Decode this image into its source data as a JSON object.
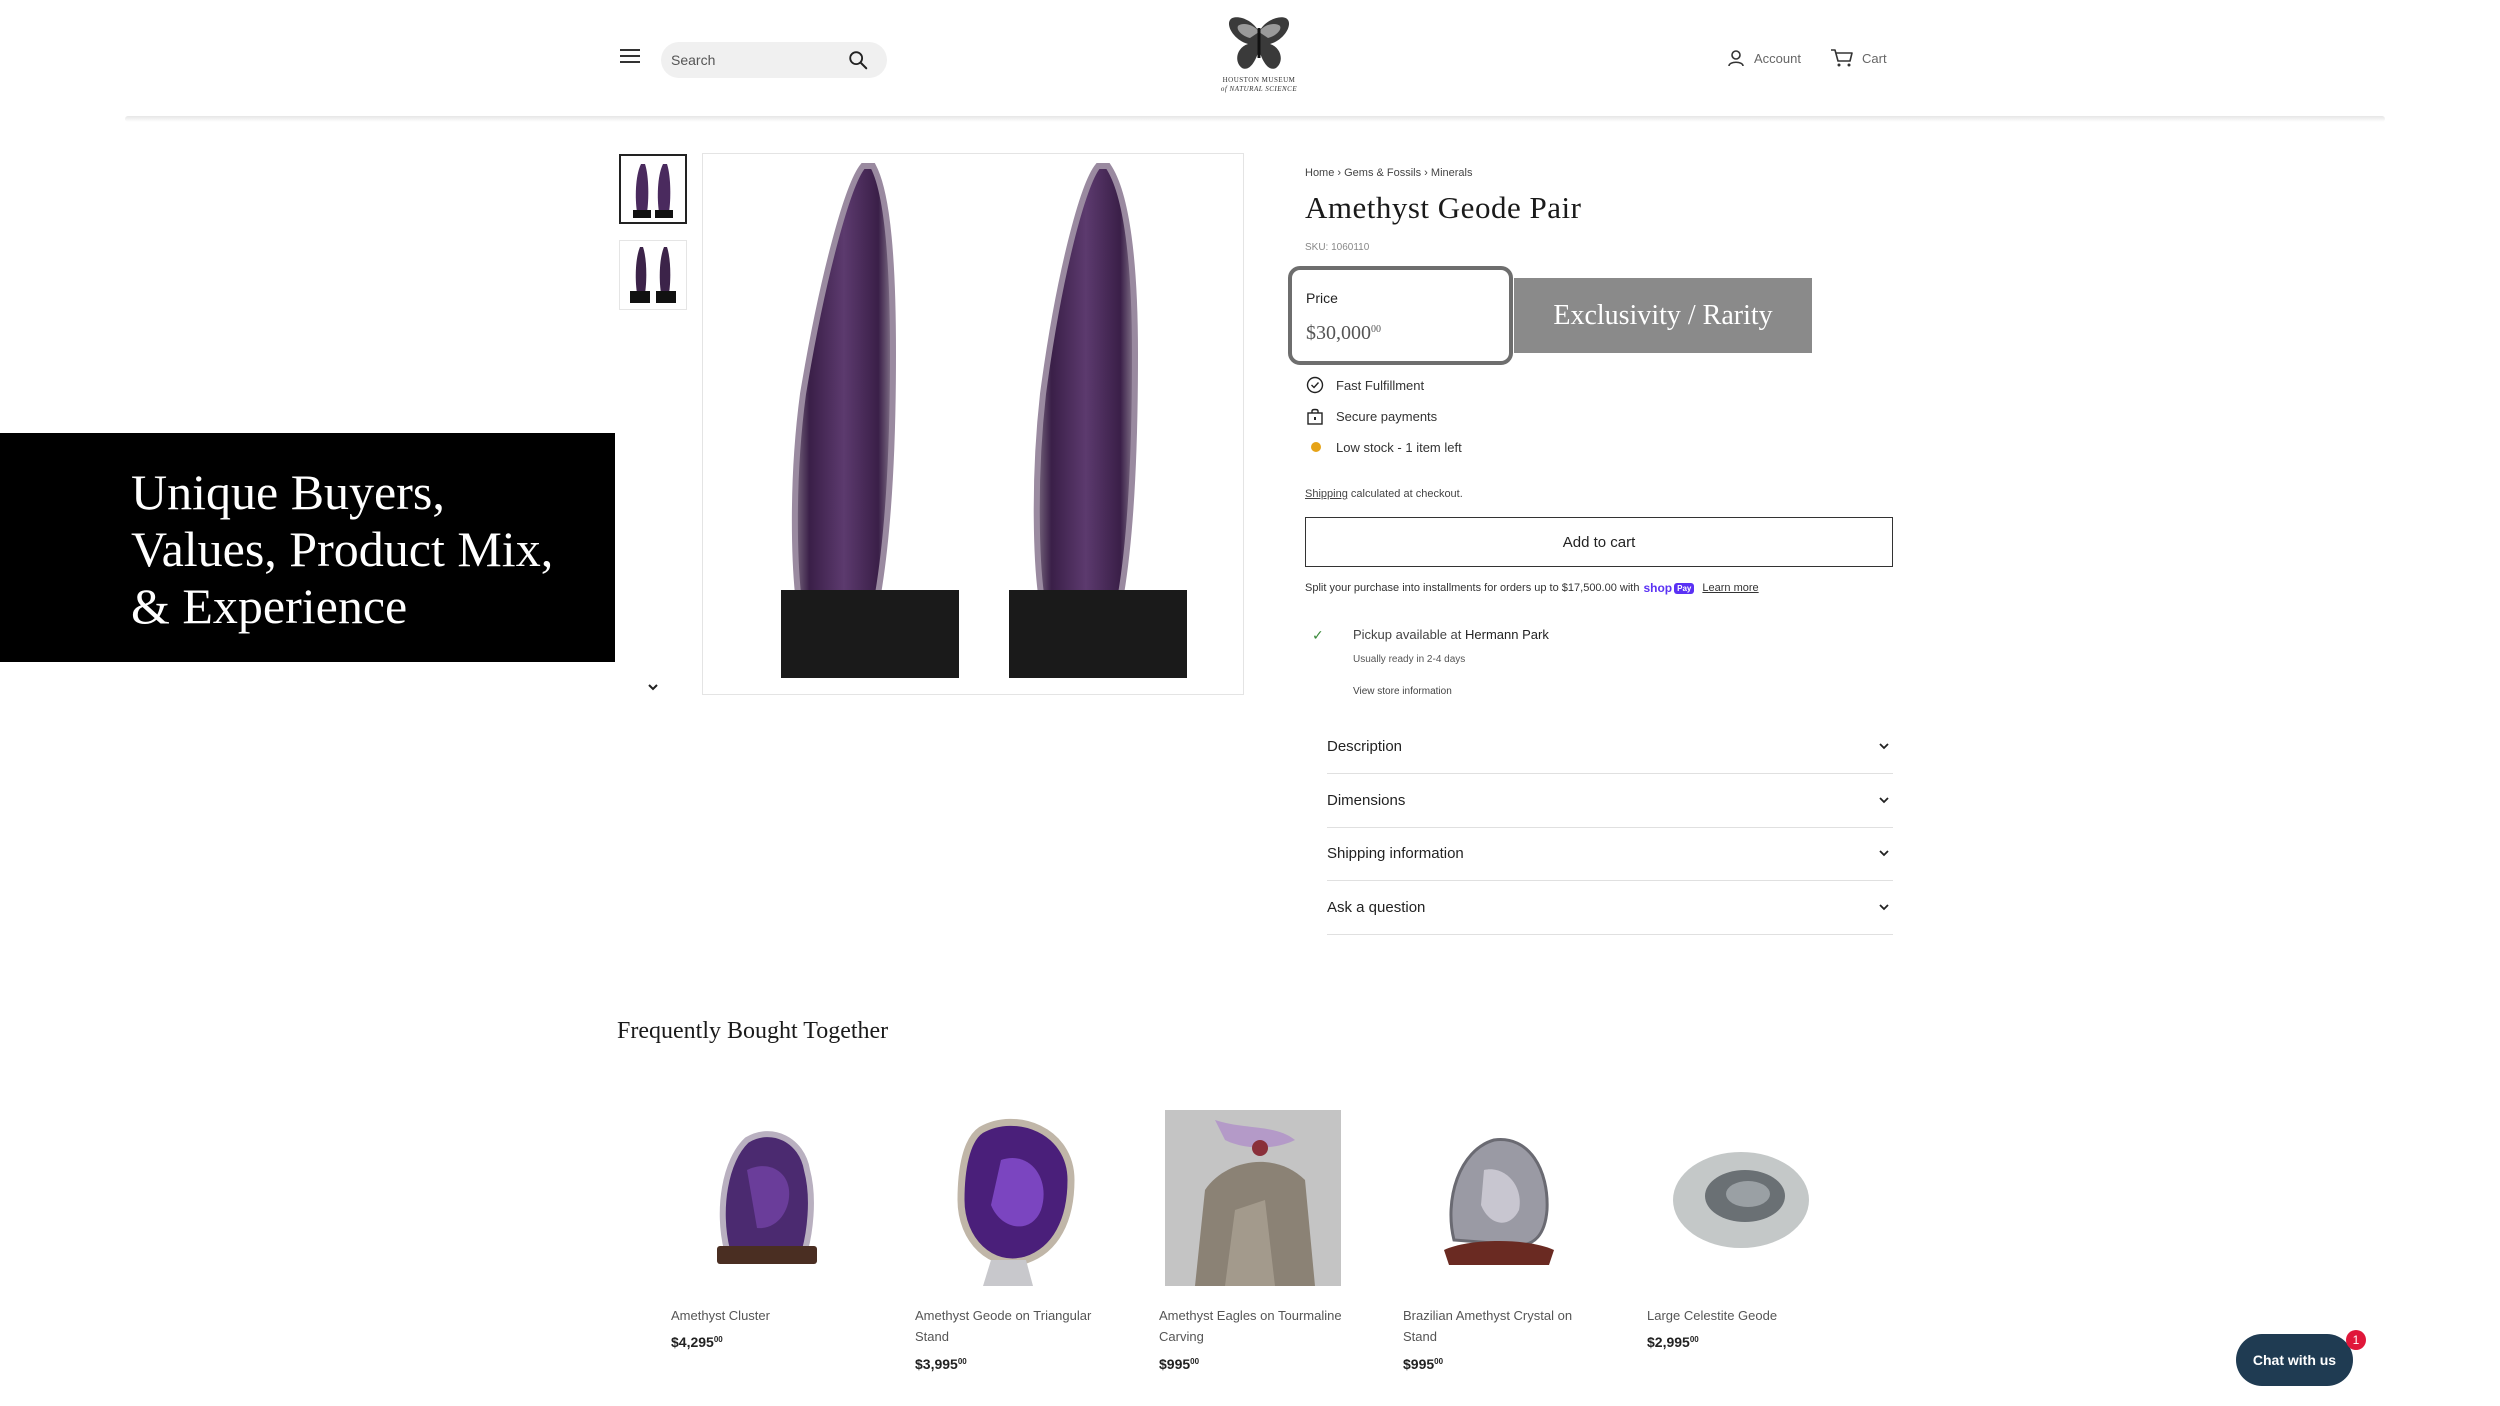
{
  "header": {
    "search_placeholder": "Search",
    "logo_lines": [
      "HOUSTON MUSEUM",
      "of NATURAL SCIENCE"
    ],
    "account_label": "Account",
    "cart_label": "Cart"
  },
  "overlay": {
    "black_box_text": "Unique Buyers, Values, Product Mix, & Experience",
    "gray_box_text": "Exclusivity / Rarity"
  },
  "product": {
    "breadcrumb": "Home › Gems & Fossils › Minerals",
    "title": "Amethyst Geode Pair",
    "sku": "SKU: 1060110",
    "price_label": "Price",
    "price_main": "$30,000",
    "price_cents": "00",
    "features": [
      "Fast Fulfillment",
      "Secure payments",
      "Low stock - 1 item left"
    ],
    "shipping_link": "Shipping",
    "shipping_rest": " calculated at checkout.",
    "add_to_cart": "Add to cart",
    "installments_text": "Split your purchase into installments for orders up to $17,500.00 with",
    "shoppay_label": "shop",
    "shoppay_pay": "Pay",
    "learn_more": "Learn more",
    "pickup_prefix": "Pickup available at ",
    "pickup_location": "Hermann Park",
    "ready_text": "Usually ready in 2-4 days",
    "view_store": "View store information",
    "accordions": [
      "Description",
      "Dimensions",
      "Shipping information",
      "Ask a question"
    ]
  },
  "fbt": {
    "title": "Frequently Bought Together",
    "items": [
      {
        "name": "Amethyst Cluster",
        "price": "$4,295",
        "cents": "00"
      },
      {
        "name": "Amethyst Geode on Triangular Stand",
        "price": "$3,995",
        "cents": "00"
      },
      {
        "name": "Amethyst Eagles on Tourmaline Carving",
        "price": "$995",
        "cents": "00"
      },
      {
        "name": "Brazilian Amethyst Crystal on Stand",
        "price": "$995",
        "cents": "00"
      },
      {
        "name": "Large Celestite Geode",
        "price": "$2,995",
        "cents": "00"
      }
    ]
  },
  "chat": {
    "label": "Chat with us",
    "badge": "1"
  },
  "colors": {
    "accent_dark": "#1f3b52",
    "stock_dot": "#e6a317",
    "amethyst": "#4a2a5e",
    "shoppay": "#5a31f4"
  },
  "icons": [
    "menu-icon",
    "search-icon",
    "account-icon",
    "cart-icon",
    "check-circle-icon",
    "lock-bag-icon",
    "stock-dot-icon",
    "check-icon",
    "chevron-down-icon"
  ]
}
